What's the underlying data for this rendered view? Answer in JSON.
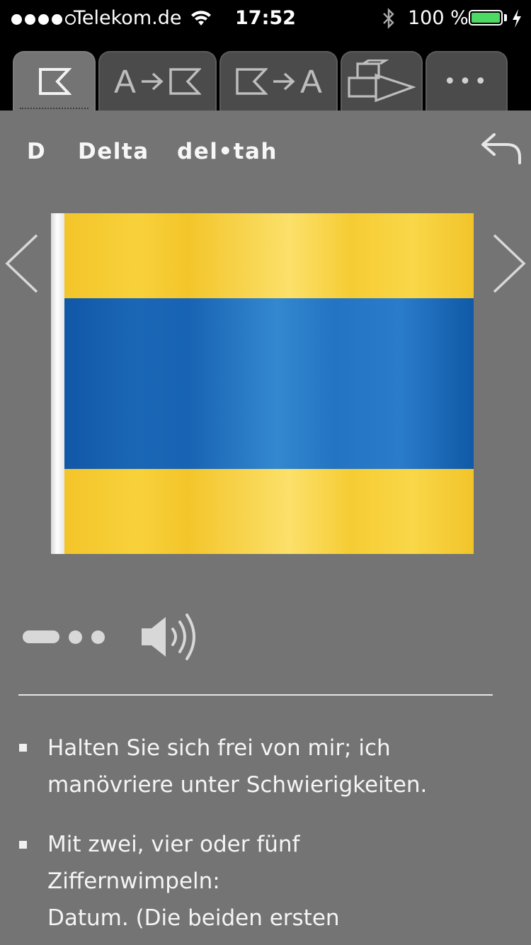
{
  "status_bar": {
    "carrier": "Telekom.de",
    "time": "17:52",
    "battery_percent": "100 %",
    "battery_level": 1.0,
    "signal_strength": 4,
    "signal_max": 5,
    "icons": [
      "wifi-icon",
      "bluetooth-icon",
      "battery-icon",
      "charging-bolt-icon"
    ]
  },
  "tabs": [
    {
      "id": "flag",
      "icon": "flag-icon",
      "active": true
    },
    {
      "id": "letter-to-flag",
      "label": "A",
      "icon": "flag-icon",
      "active": false
    },
    {
      "id": "flag-to-letter",
      "label": "A",
      "icon": "flag-icon",
      "active": false
    },
    {
      "id": "shapes",
      "icon": "shapes-icon",
      "active": false
    },
    {
      "id": "more",
      "label": "•••",
      "icon": "more-icon",
      "active": false
    }
  ],
  "entry": {
    "letter": "D",
    "word": "Delta",
    "pronunciation": "del•tah"
  },
  "flag": {
    "stripes": [
      "#f5c93a",
      "#2271bf",
      "#f5c93a"
    ],
    "pole_color": "#f0f0f0"
  },
  "morse": [
    "dash",
    "dot",
    "dot"
  ],
  "meanings": [
    "Halten Sie sich frei von mir; ich\nmanövriere unter Schwierigkeiten.",
    "Mit zwei, vier oder fünf\nZiffernwimpeln:\nDatum. (Die beiden ersten"
  ],
  "colors": {
    "background": "#747474",
    "tab_bar": "#000000",
    "tab_inactive": "#4b4b4b",
    "battery_fill": "#4cd964"
  }
}
